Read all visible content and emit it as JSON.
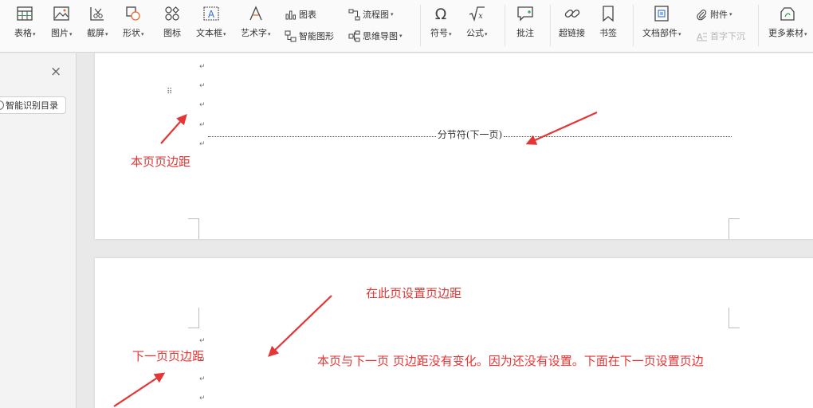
{
  "ribbon": {
    "buttons": [
      {
        "label": "表格",
        "icon": "table-icon",
        "dropdown": true
      },
      {
        "label": "图片",
        "icon": "picture-icon",
        "dropdown": true
      },
      {
        "label": "截屏",
        "icon": "screenshot-icon",
        "dropdown": true
      },
      {
        "label": "形状",
        "icon": "shape-icon",
        "dropdown": true
      },
      {
        "label": "图标",
        "icon": "icon-library-icon",
        "dropdown": false
      },
      {
        "label": "文本框",
        "icon": "textbox-icon",
        "dropdown": true
      },
      {
        "label": "艺术字",
        "icon": "wordart-icon",
        "dropdown": true
      },
      {
        "label": "符号",
        "icon": "omega-icon",
        "dropdown": true
      },
      {
        "label": "公式",
        "icon": "formula-icon",
        "dropdown": true
      },
      {
        "label": "批注",
        "icon": "comment-icon",
        "dropdown": false
      },
      {
        "label": "超链接",
        "icon": "hyperlink-icon",
        "dropdown": false
      },
      {
        "label": "书签",
        "icon": "bookmark-icon",
        "dropdown": false
      },
      {
        "label": "文档部件",
        "icon": "doc-parts-icon",
        "dropdown": true
      },
      {
        "label": "更多素材",
        "icon": "more-assets-icon",
        "dropdown": true
      }
    ],
    "small": {
      "chart": "图表",
      "smartart": "智能图形",
      "flowchart": "流程图",
      "mindmap": "思维导图",
      "attachment": "附件",
      "dropcap": "首字下沉"
    }
  },
  "nav": {
    "close_icon": "×",
    "smart_toc_label": "智能识别目录"
  },
  "document": {
    "para_mark": "↵",
    "section_break_label": "分节符(下一页)",
    "drag_handle": "⠿"
  },
  "annotations": {
    "this_page_margin": "本页页边距",
    "set_margin_here": "在此页设置页边距",
    "next_page_margin": "下一页页边距",
    "explanation": "本页与下一页 页边距没有变化。因为还没有设置。下面在下一页设置页边"
  },
  "colors": {
    "annotation": "#e53535",
    "ribbon_bg": "#fafafa",
    "canvas_bg": "#e9e9e9"
  }
}
